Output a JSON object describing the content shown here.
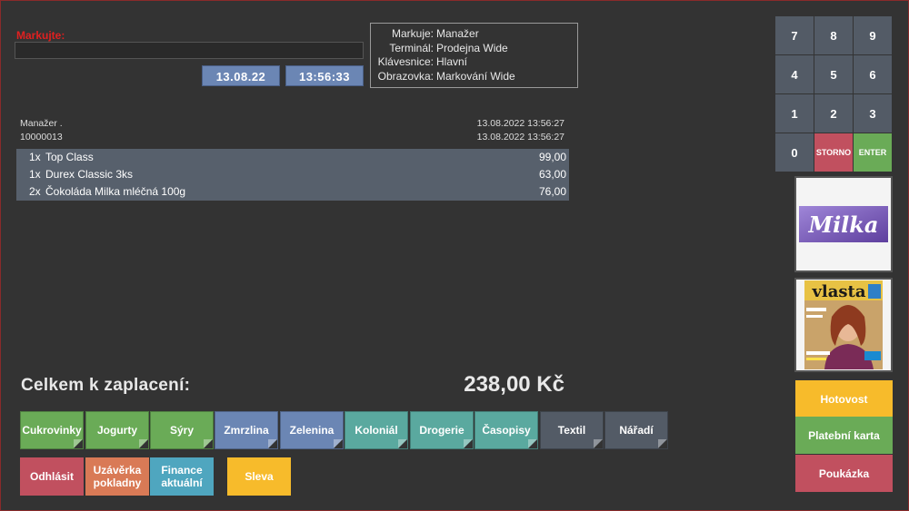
{
  "input": {
    "label": "Markujte:",
    "value": ""
  },
  "datetime": {
    "date": "13.08.22",
    "time": "13:56:33"
  },
  "info": [
    {
      "key": "Markuje:",
      "value": "Manažer"
    },
    {
      "key": "Terminál:",
      "value": "Prodejna Wide"
    },
    {
      "key": "Klávesnice:",
      "value": "Hlavní"
    },
    {
      "key": "Obrazovka:",
      "value": "Markování Wide"
    }
  ],
  "receipt": {
    "user": "Manažer .",
    "id": "10000013",
    "datetime1": "13.08.2022 13:56:27",
    "datetime2": "13.08.2022 13:56:27",
    "items": [
      {
        "qty": "1x",
        "name": "Top Class",
        "price": "99,00"
      },
      {
        "qty": "1x",
        "name": "Durex Classic 3ks",
        "price": "63,00"
      },
      {
        "qty": "2x",
        "name": "Čokoláda Milka mléčná 100g",
        "price": "76,00"
      }
    ]
  },
  "total": {
    "label": "Celkem k zaplacení:",
    "value": "238,00 Kč"
  },
  "categories": [
    {
      "label": "Cukrovinky",
      "color": "#6aab57"
    },
    {
      "label": "Jogurty",
      "color": "#6aab57"
    },
    {
      "label": "Sýry",
      "color": "#6aab57"
    },
    {
      "label": "Zmrzlina",
      "color": "#6b86b4"
    },
    {
      "label": "Zelenina",
      "color": "#6b86b4"
    },
    {
      "label": "Koloniál",
      "color": "#5aa99f"
    },
    {
      "label": "Drogerie",
      "color": "#5aa99f"
    },
    {
      "label": "Časopisy",
      "color": "#5aa99f"
    },
    {
      "label": "Textil",
      "color": "#535b66"
    },
    {
      "label": "Nářadí",
      "color": "#535b66"
    }
  ],
  "actions": {
    "logout": "Odhlásit",
    "closing_line1": "Uzávěrka",
    "closing_line2": "pokladny",
    "finance_line1": "Finance",
    "finance_line2": "aktuální",
    "discount": "Sleva"
  },
  "keypad": {
    "k7": "7",
    "k8": "8",
    "k9": "9",
    "k4": "4",
    "k5": "5",
    "k6": "6",
    "k1": "1",
    "k2": "2",
    "k3": "3",
    "k0": "0",
    "storno": "STORNO",
    "enter": "ENTER"
  },
  "products": {
    "milka_logo": "Milka",
    "vlasta_logo": "vlasta"
  },
  "payment": {
    "cash": "Hotovost",
    "card": "Platební karta",
    "voucher": "Poukázka"
  }
}
